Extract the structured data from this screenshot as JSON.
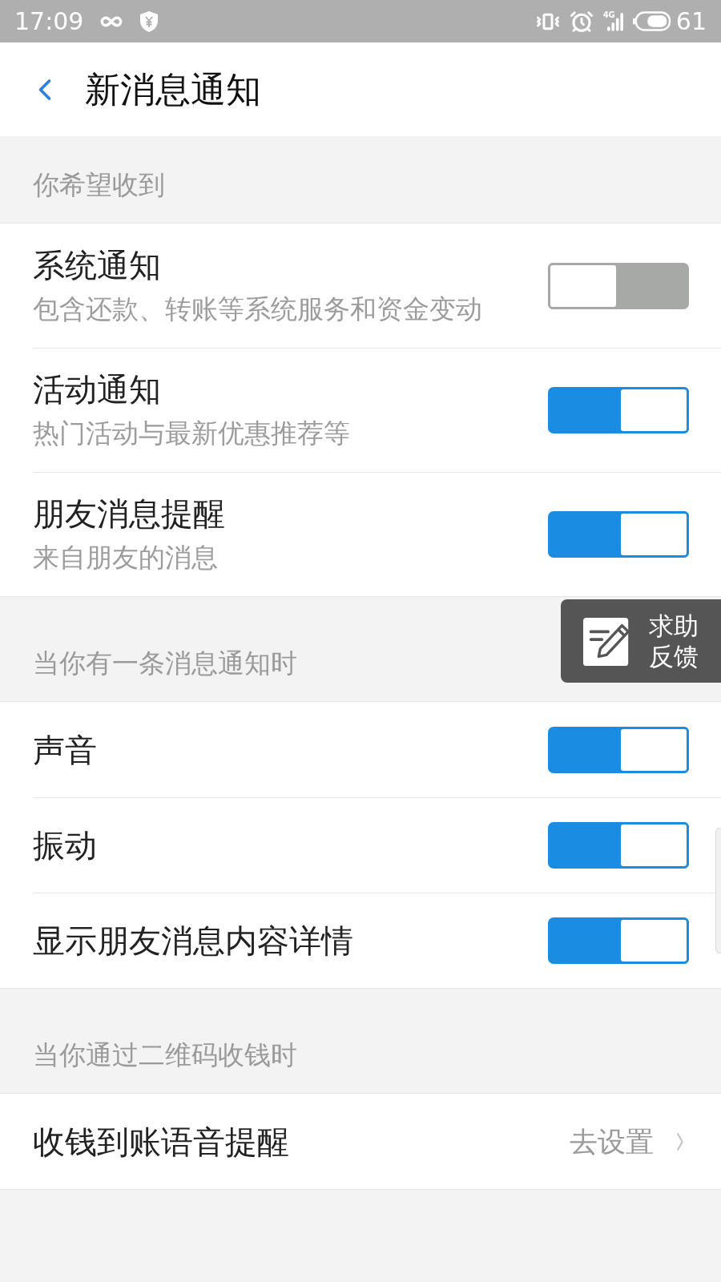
{
  "status_bar": {
    "time": "17:09",
    "network": "4G",
    "battery": "61"
  },
  "header": {
    "title": "新消息通知"
  },
  "sections": [
    {
      "heading": "你希望收到",
      "items": [
        {
          "kind": "toggle",
          "title": "系统通知",
          "subtitle": "包含还款、转账等系统服务和资金变动",
          "on": false
        },
        {
          "kind": "toggle",
          "title": "活动通知",
          "subtitle": "热门活动与最新优惠推荐等",
          "on": true
        },
        {
          "kind": "toggle",
          "title": "朋友消息提醒",
          "subtitle": "来自朋友的消息",
          "on": true
        }
      ]
    },
    {
      "heading": "当你有一条消息通知时",
      "items": [
        {
          "kind": "toggle",
          "title": "声音",
          "on": true
        },
        {
          "kind": "toggle",
          "title": "振动",
          "on": true
        },
        {
          "kind": "toggle",
          "title": "显示朋友消息内容详情",
          "on": true
        }
      ]
    },
    {
      "heading": "当你通过二维码收钱时",
      "items": [
        {
          "kind": "link",
          "title": "收钱到账语音提醒",
          "value": "去设置"
        }
      ]
    }
  ],
  "help_button": {
    "label": "求助反馈"
  }
}
